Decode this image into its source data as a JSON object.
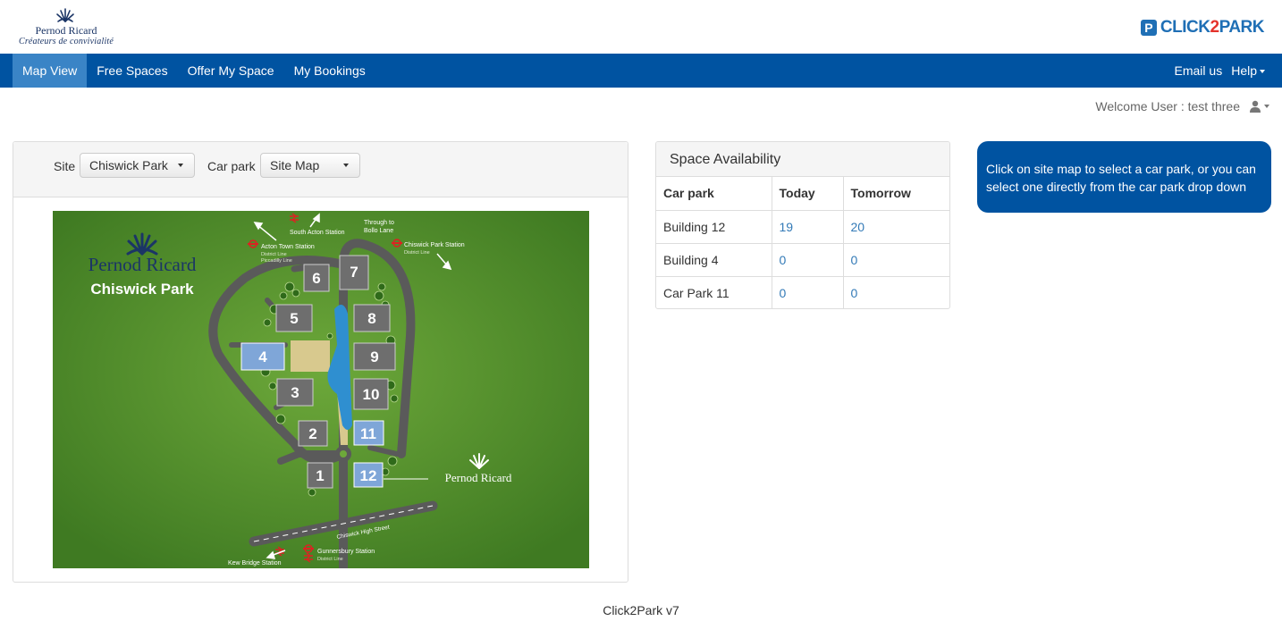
{
  "header": {
    "left_brand_name": "Pernod Ricard",
    "left_brand_tagline": "Créateurs de convivialité",
    "right_brand_icon": "P",
    "right_brand_part1": "CLICK",
    "right_brand_part2": "2",
    "right_brand_part3": "PARK"
  },
  "nav": {
    "items": [
      {
        "label": "Map View"
      },
      {
        "label": "Free Spaces"
      },
      {
        "label": "Offer My Space"
      },
      {
        "label": "My Bookings"
      }
    ],
    "email": "Email us",
    "help": "Help"
  },
  "welcome": {
    "text": "Welcome User : test three"
  },
  "filters": {
    "site_label": "Site",
    "site_value": "Chiswick Park",
    "carpark_label": "Car park",
    "carpark_value": "Site Map"
  },
  "map": {
    "brand": "Pernod Ricard",
    "site_name": "Chiswick Park",
    "stations": {
      "south_acton": "South Acton Station",
      "through_1": "Through to",
      "through_2": "Bollo Lane",
      "acton_town": "Acton Town Station",
      "acton_lines_1": "District Line",
      "acton_lines_2": "Piccadilly Line",
      "chiswick_park": "Chiswick Park Station",
      "chiswick_line": "District Line",
      "high_street": "Chiswick High Street",
      "gunnersbury": "Gunnersbury Station",
      "gunnersbury_line": "District Line",
      "kew_bridge": "Kew Bridge Station"
    },
    "buildings": [
      "1",
      "2",
      "3",
      "4",
      "5",
      "6",
      "7",
      "8",
      "9",
      "10",
      "11",
      "12"
    ],
    "hq_label": "Pernod Ricard",
    "colors": {
      "grass": "#4f8a2c",
      "road": "#5a5a5a",
      "building": "#6e6e6e",
      "selectable": "#7fa6d8",
      "water": "#2f8fd0",
      "sand": "#d8c98e"
    }
  },
  "availability": {
    "title": "Space Availability",
    "columns": [
      "Car park",
      "Today",
      "Tomorrow"
    ],
    "rows": [
      {
        "name": "Building 12",
        "today": "19",
        "tomorrow": "20"
      },
      {
        "name": "Building 4",
        "today": "0",
        "tomorrow": "0"
      },
      {
        "name": "Car Park 11",
        "today": "0",
        "tomorrow": "0"
      }
    ]
  },
  "info": {
    "text": "Click on site map to select a car park, or you can select one directly from the car park drop down"
  },
  "footer": {
    "text": "Click2Park v7"
  }
}
